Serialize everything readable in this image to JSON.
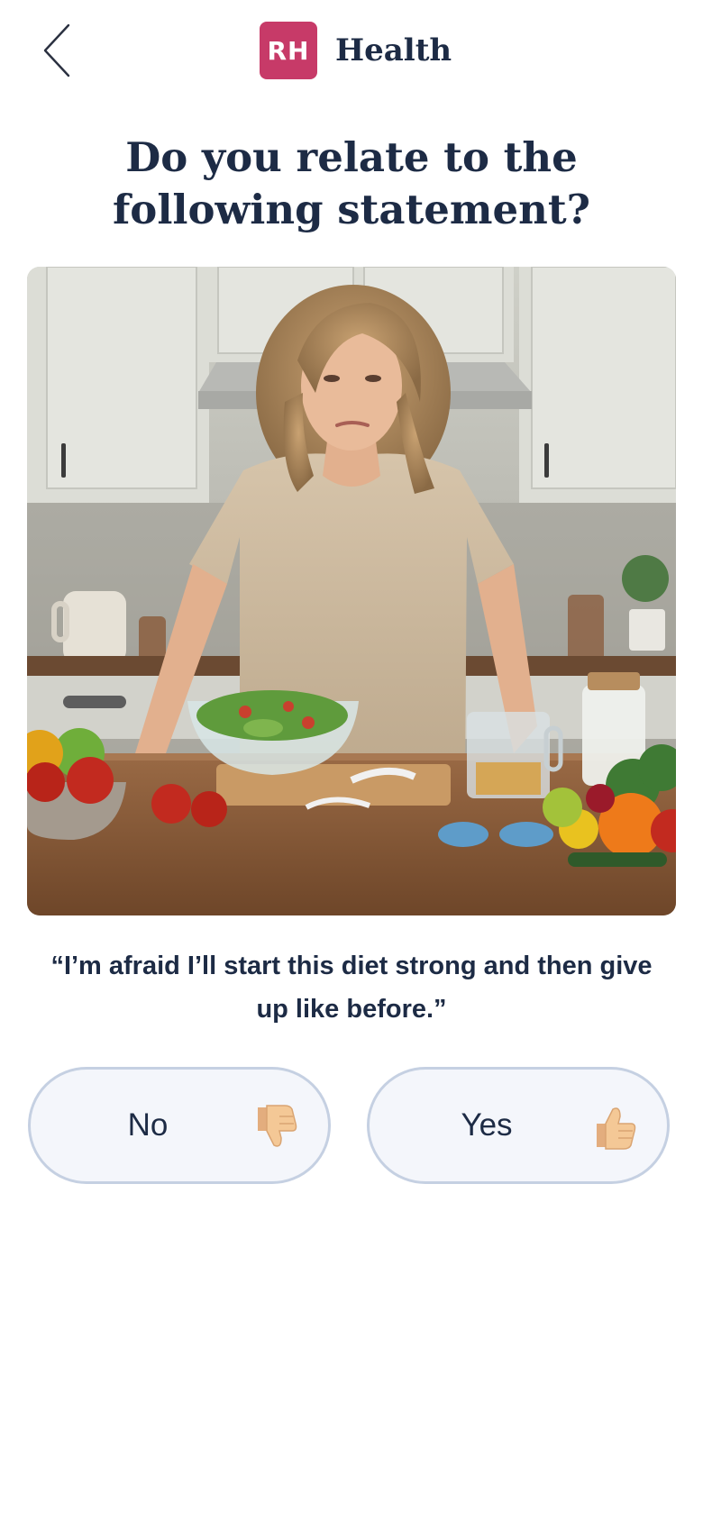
{
  "header": {
    "back_icon": "chevron-left-icon",
    "logo_text": "RH",
    "brand_name": "Health"
  },
  "question": "Do you relate to the following statement?",
  "image": {
    "alt": "Woman standing at a kitchen counter with salad, vegetables, fruit and a tape measure"
  },
  "statement": "“I’m afraid I’ll start this diet strong and then give up like before.”",
  "answers": [
    {
      "label": "No",
      "icon": "thumbs-down-icon"
    },
    {
      "label": "Yes",
      "icon": "thumbs-up-icon"
    }
  ],
  "colors": {
    "logo_bg": "#c73a68",
    "text": "#1d2b45",
    "button_bg": "#f4f6fb",
    "button_border": "#c5d0e2",
    "thumb": "#f4c896"
  }
}
